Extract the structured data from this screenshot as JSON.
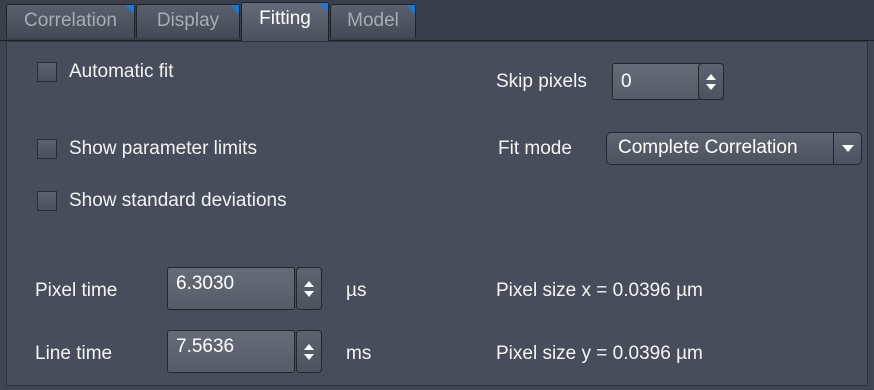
{
  "tabs": [
    {
      "label": "Correlation",
      "active": false
    },
    {
      "label": "Display",
      "active": false
    },
    {
      "label": "Fitting",
      "active": true
    },
    {
      "label": "Model",
      "active": false
    }
  ],
  "options": {
    "automatic_fit": {
      "label": "Automatic fit",
      "checked": false
    },
    "show_parameter_limits": {
      "label": "Show parameter limits",
      "checked": false
    },
    "show_standard_deviations": {
      "label": "Show standard deviations",
      "checked": false
    }
  },
  "skip_pixels": {
    "label": "Skip pixels",
    "value": "0"
  },
  "fit_mode": {
    "label": "Fit mode",
    "value": "Complete Correlation"
  },
  "pixel_time": {
    "label": "Pixel time",
    "value": "6.3030",
    "unit": "µs"
  },
  "line_time": {
    "label": "Line time",
    "value": "7.5636",
    "unit": "ms"
  },
  "pixel_size_x": "Pixel size x = 0.0396 µm",
  "pixel_size_y": "Pixel size y = 0.0396 µm",
  "colors": {
    "accent": "#1e78d8",
    "panel": "#474d5a",
    "background": "#3f4552"
  }
}
